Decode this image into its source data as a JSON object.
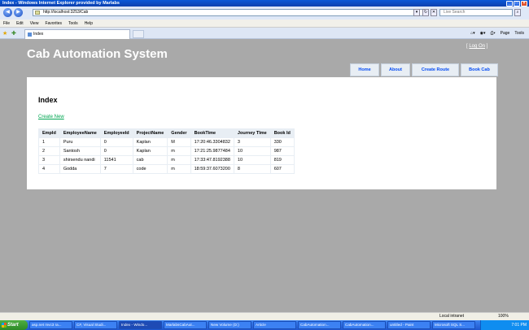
{
  "window": {
    "title": "Index - Windows Internet Explorer provided by Marlabs",
    "address": "http://localhost:3253/Cab",
    "search_placeholder": "Live Search"
  },
  "menubar": [
    "File",
    "Edit",
    "View",
    "Favorites",
    "Tools",
    "Help"
  ],
  "tab": {
    "label": "Index"
  },
  "toolbar": {
    "page": "Page",
    "tools": "Tools"
  },
  "site": {
    "title": "Cab Automation System",
    "logon": "Log On"
  },
  "nav": [
    "Home",
    "About",
    "Create Route",
    "Book Cab"
  ],
  "content": {
    "heading": "Index",
    "create_link": "Create New",
    "columns": [
      "EmpId",
      "EmployeeName",
      "EmployeeId",
      "ProjectName",
      "Gender",
      "BookTime",
      "Journey TIme",
      "Book Id"
    ],
    "rows": [
      [
        "1",
        "Puru",
        "0",
        "Kaplan",
        "M",
        "17:20:46.3304832",
        "3",
        "330"
      ],
      [
        "2",
        "Santosh",
        "0",
        "Kaplan",
        "m",
        "17:21:25.9877484",
        "10",
        "987"
      ],
      [
        "3",
        "shirsendu nandi",
        "11541",
        "cab",
        "m",
        "17:33:47.8192388",
        "10",
        "819"
      ],
      [
        "4",
        "Godda",
        "7",
        "code",
        "m",
        "18:59:37.6073200",
        "8",
        "607"
      ]
    ]
  },
  "statusbar": {
    "zone": "Local intranet",
    "zoom": "100%"
  },
  "taskbar": {
    "start": "Start",
    "tasks": [
      "asp.net mvc3 ra...",
      "C#, Visual Studi...",
      "Index - Windo...",
      "MarlabsCabAut...",
      "New Volume (D:)",
      "Article",
      "CabAutomation...",
      "CabAutomation...",
      "untitled - Paint",
      "Microsoft SQL S..."
    ],
    "clock": "7:01 PM"
  }
}
